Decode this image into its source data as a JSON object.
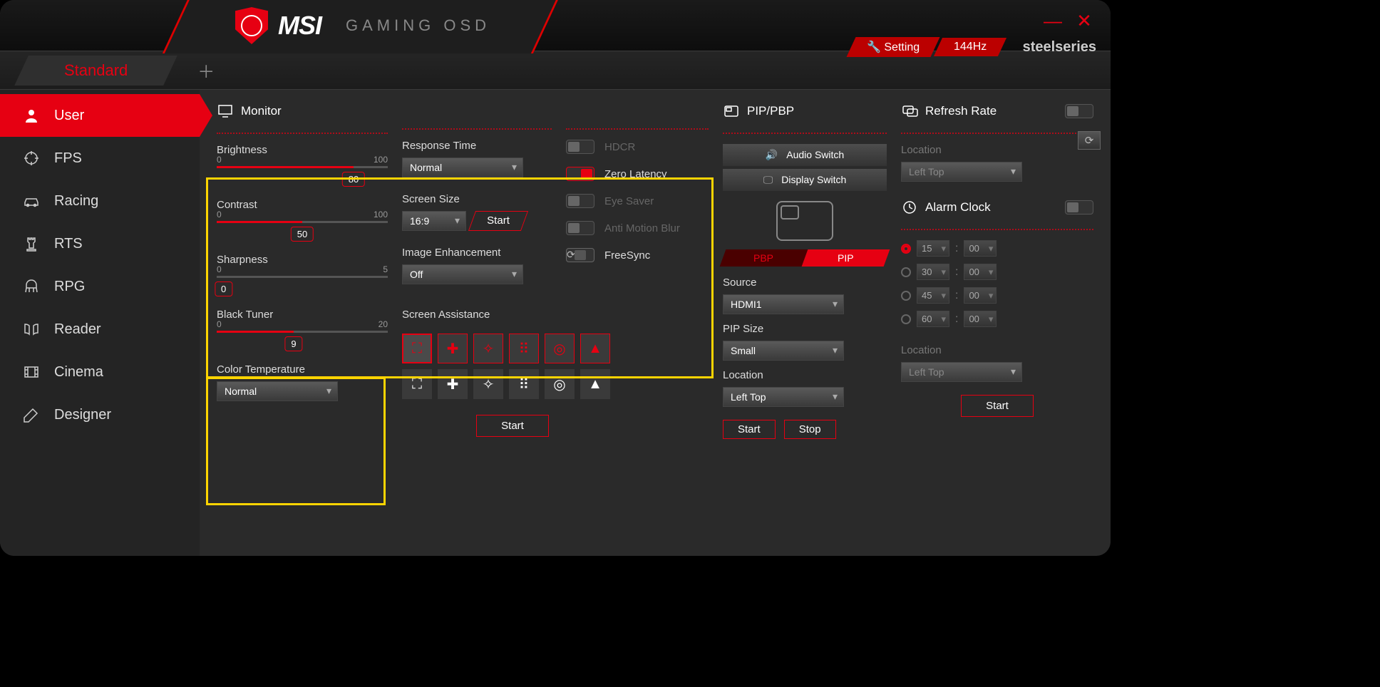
{
  "header": {
    "brand": "MSI",
    "subtitle": "GAMING OSD",
    "setting_label": "Setting",
    "refresh_value": "144Hz",
    "partner": "steelseries"
  },
  "tabs": {
    "active": "Standard"
  },
  "sidebar": {
    "items": [
      {
        "label": "User",
        "icon": "user-icon"
      },
      {
        "label": "FPS",
        "icon": "crosshair-icon"
      },
      {
        "label": "Racing",
        "icon": "car-icon"
      },
      {
        "label": "RTS",
        "icon": "chess-icon"
      },
      {
        "label": "RPG",
        "icon": "helmet-icon"
      },
      {
        "label": "Reader",
        "icon": "book-icon"
      },
      {
        "label": "Cinema",
        "icon": "film-icon"
      },
      {
        "label": "Designer",
        "icon": "pen-icon"
      }
    ]
  },
  "monitor": {
    "title": "Monitor",
    "brightness": {
      "label": "Brightness",
      "min": 0,
      "max": 100,
      "value": 80
    },
    "contrast": {
      "label": "Contrast",
      "min": 0,
      "max": 100,
      "value": 50
    },
    "sharpness": {
      "label": "Sharpness",
      "min": 0,
      "max": 5,
      "value": 0
    },
    "black_tuner": {
      "label": "Black Tuner",
      "min": 0,
      "max": 20,
      "value": 9
    },
    "color_temperature": {
      "label": "Color Temperature",
      "value": "Normal"
    },
    "response_time": {
      "label": "Response Time",
      "value": "Normal"
    },
    "screen_size": {
      "label": "Screen Size",
      "value": "16:9",
      "start": "Start"
    },
    "image_enhancement": {
      "label": "Image Enhancement",
      "value": "Off"
    },
    "toggles": {
      "hdcr": {
        "label": "HDCR",
        "on": false,
        "enabled": false
      },
      "zero_latency": {
        "label": "Zero Latency",
        "on": true,
        "enabled": true
      },
      "eye_saver": {
        "label": "Eye Saver",
        "on": false,
        "enabled": false
      },
      "anti_motion_blur": {
        "label": "Anti Motion Blur",
        "on": false,
        "enabled": false
      },
      "freesync": {
        "label": "FreeSync",
        "on": false,
        "enabled": true
      }
    },
    "screen_assistance": {
      "label": "Screen Assistance",
      "start": "Start"
    }
  },
  "pip": {
    "title": "PIP/PBP",
    "audio_switch": "Audio Switch",
    "display_switch": "Display Switch",
    "tabs": {
      "pbp": "PBP",
      "pip": "PIP"
    },
    "source": {
      "label": "Source",
      "value": "HDMI1"
    },
    "pip_size": {
      "label": "PIP Size",
      "value": "Small"
    },
    "location": {
      "label": "Location",
      "value": "Left Top"
    },
    "start": "Start",
    "stop": "Stop"
  },
  "refresh": {
    "title": "Refresh Rate",
    "on": false,
    "location": {
      "label": "Location",
      "value": "Left Top"
    }
  },
  "alarm": {
    "title": "Alarm Clock",
    "on": false,
    "rows": [
      {
        "m": "15",
        "s": "00",
        "selected": true
      },
      {
        "m": "30",
        "s": "00",
        "selected": false
      },
      {
        "m": "45",
        "s": "00",
        "selected": false
      },
      {
        "m": "60",
        "s": "00",
        "selected": false
      }
    ],
    "location": {
      "label": "Location",
      "value": "Left Top"
    },
    "start": "Start"
  }
}
